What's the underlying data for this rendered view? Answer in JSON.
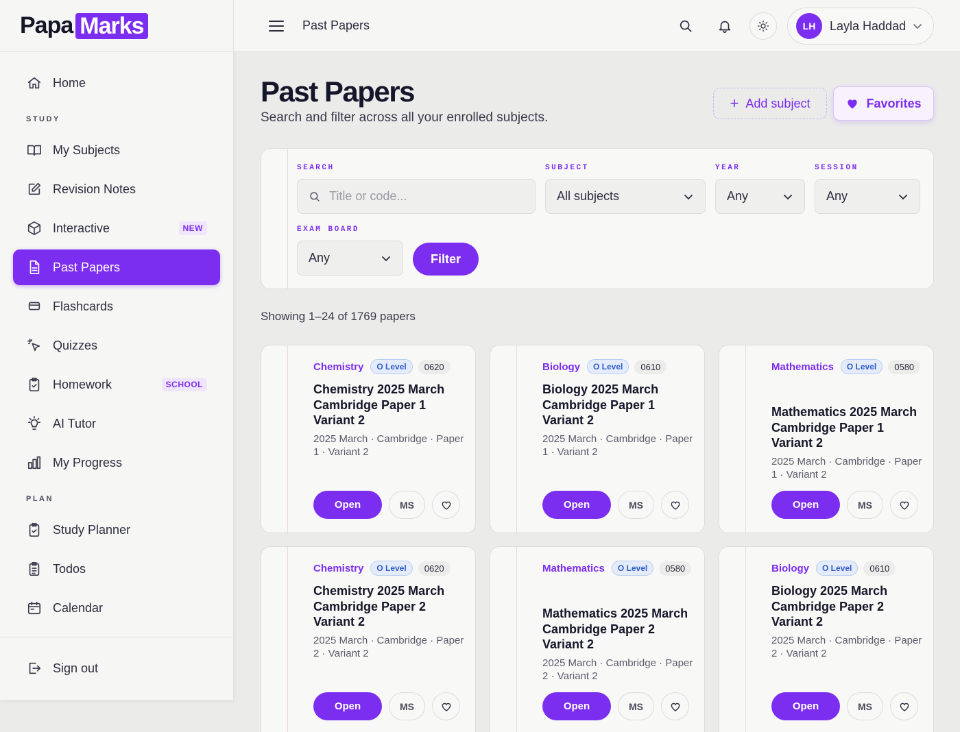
{
  "logo": {
    "text": "Papa",
    "badge": "Marks"
  },
  "sidebar": {
    "home": "Home",
    "sections": {
      "study": "STUDY",
      "plan": "PLAN"
    },
    "items": [
      {
        "label": "My Subjects",
        "icon": "book-icon"
      },
      {
        "label": "Revision Notes",
        "icon": "edit-icon"
      },
      {
        "label": "Interactive",
        "icon": "cube-icon",
        "badge": "NEW"
      },
      {
        "label": "Past Papers",
        "icon": "document-icon",
        "active": true
      },
      {
        "label": "Flashcards",
        "icon": "cards-icon"
      },
      {
        "label": "Quizzes",
        "icon": "cursor-click-icon"
      },
      {
        "label": "Homework",
        "icon": "clipboard-check-icon",
        "badge": "SCHOOL"
      },
      {
        "label": "AI Tutor",
        "icon": "lightbulb-icon"
      },
      {
        "label": "My Progress",
        "icon": "bar-chart-icon"
      }
    ],
    "plan_items": [
      {
        "label": "Study Planner",
        "icon": "clipboard-check-icon"
      },
      {
        "label": "Todos",
        "icon": "clipboard-list-icon"
      },
      {
        "label": "Calendar",
        "icon": "calendar-icon"
      }
    ],
    "sign_out": "Sign out"
  },
  "topbar": {
    "title": "Past Papers",
    "user": {
      "initials": "LH",
      "name": "Layla Haddad"
    }
  },
  "page": {
    "title": "Past Papers",
    "subtitle": "Search and filter across all your enrolled subjects.",
    "add_subject": "Add subject",
    "favorites": "Favorites"
  },
  "filters": {
    "search_label": "SEARCH",
    "search_placeholder": "Title or code...",
    "subject_label": "SUBJECT",
    "subject_value": "All subjects",
    "year_label": "YEAR",
    "year_value": "Any",
    "session_label": "SESSION",
    "session_value": "Any",
    "board_label": "EXAM BOARD",
    "board_value": "Any",
    "filter_button": "Filter"
  },
  "results": {
    "showing": "Showing 1–24 of 1769 papers"
  },
  "papers": [
    {
      "subject": "Chemistry",
      "level": "O Level",
      "code": "0620",
      "title": "Chemistry 2025 March Cambridge Paper 1 Variant 2",
      "desc": "2025 March · Cambridge · Paper 1 · Variant 2",
      "open": "Open",
      "ms": "MS"
    },
    {
      "subject": "Biology",
      "level": "O Level",
      "code": "0610",
      "title": "Biology 2025 March Cambridge Paper 1 Variant 2",
      "desc": "2025 March · Cambridge · Paper 1 · Variant 2",
      "open": "Open",
      "ms": "MS"
    },
    {
      "subject": "Mathematics",
      "level": "O Level",
      "code": "0580",
      "title": "Mathematics 2025 March Cambridge Paper 1 Variant 2",
      "desc": "2025 March · Cambridge · Paper 1 · Variant 2",
      "open": "Open",
      "ms": "MS"
    },
    {
      "subject": "Chemistry",
      "level": "O Level",
      "code": "0620",
      "title": "Chemistry 2025 March Cambridge Paper 2 Variant 2",
      "desc": "2025 March · Cambridge · Paper 2 · Variant 2",
      "open": "Open",
      "ms": "MS"
    },
    {
      "subject": "Mathematics",
      "level": "O Level",
      "code": "0580",
      "title": "Mathematics 2025 March Cambridge Paper 2 Variant 2",
      "desc": "2025 March · Cambridge · Paper 2 · Variant 2",
      "open": "Open",
      "ms": "MS"
    },
    {
      "subject": "Biology",
      "level": "O Level",
      "code": "0610",
      "title": "Biology 2025 March Cambridge Paper 2 Variant 2",
      "desc": "2025 March · Cambridge · Paper 2 · Variant 2",
      "open": "Open",
      "ms": "MS"
    }
  ],
  "colors": {
    "accent": "#7c2ef0",
    "level_badge": "#2f5ccc"
  }
}
